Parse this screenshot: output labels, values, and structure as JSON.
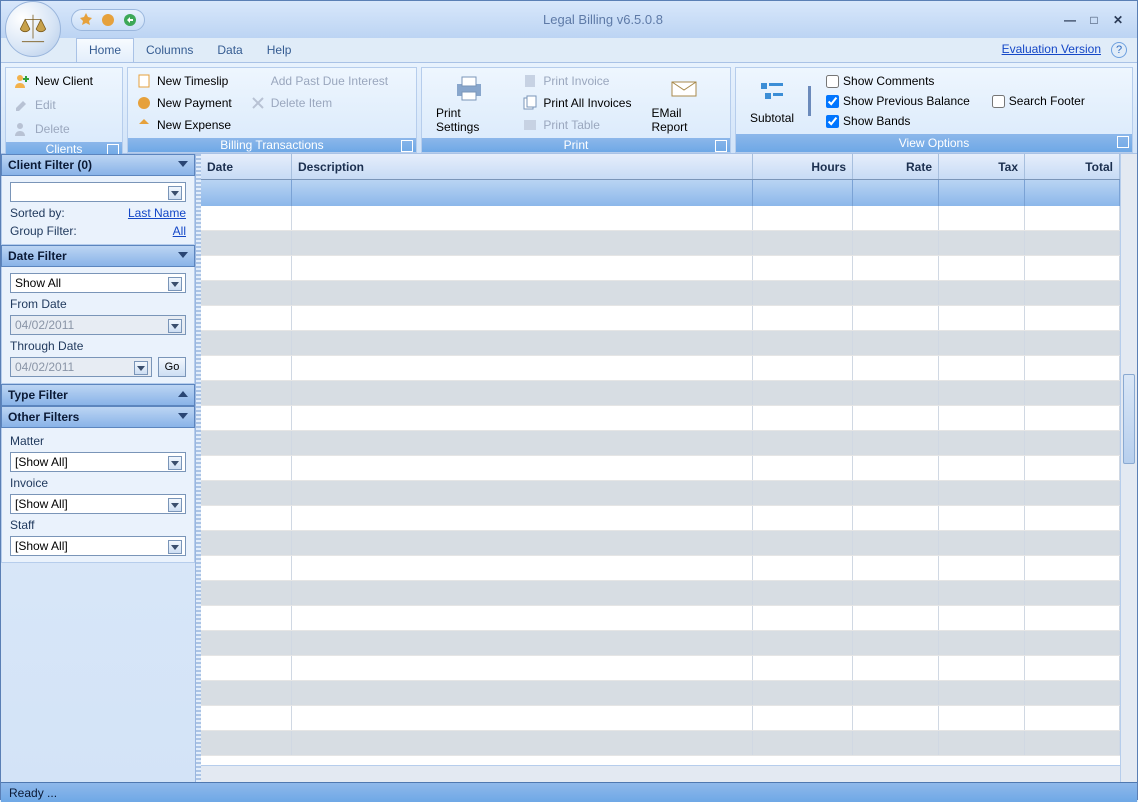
{
  "app": {
    "title": "Legal Billing v6.5.0.8",
    "evaluation": "Evaluation Version",
    "status": "Ready ..."
  },
  "tabs": {
    "home": "Home",
    "columns": "Columns",
    "data": "Data",
    "help": "Help"
  },
  "ribbon": {
    "clients": {
      "title": "Clients",
      "new_client": "New Client",
      "edit": "Edit",
      "delete": "Delete"
    },
    "billing": {
      "title": "Billing Transactions",
      "new_timeslip": "New Timeslip",
      "new_payment": "New Payment",
      "new_expense": "New Expense",
      "add_past_due": "Add Past Due Interest",
      "delete_item": "Delete Item"
    },
    "print": {
      "title": "Print",
      "settings": "Print Settings",
      "invoice": "Print Invoice",
      "all_invoices": "Print All Invoices",
      "table": "Print Table",
      "email": "EMail Report"
    },
    "view": {
      "title": "View Options",
      "subtotal": "Subtotal",
      "show_comments": "Show Comments",
      "show_prev": "Show Previous Balance",
      "show_bands": "Show Bands",
      "search_footer": "Search Footer"
    }
  },
  "filters": {
    "client": {
      "title": "Client Filter (0)",
      "sorted_by": "Sorted by:",
      "last_name": "Last Name",
      "group_filter": "Group Filter:",
      "all": "All"
    },
    "date": {
      "title": "Date Filter",
      "show_all": "Show All",
      "from_label": "From Date",
      "from_value": "04/02/2011",
      "through_label": "Through Date",
      "through_value": "04/02/2011",
      "go": "Go"
    },
    "type": {
      "title": "Type Filter"
    },
    "other": {
      "title": "Other Filters",
      "matter_label": "Matter",
      "matter_value": "[Show All]",
      "invoice_label": "Invoice",
      "invoice_value": "[Show All]",
      "staff_label": "Staff",
      "staff_value": "[Show All]"
    }
  },
  "grid": {
    "date": "Date",
    "description": "Description",
    "hours": "Hours",
    "rate": "Rate",
    "tax": "Tax",
    "total": "Total"
  }
}
